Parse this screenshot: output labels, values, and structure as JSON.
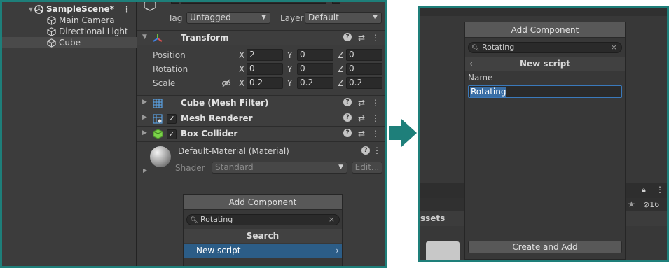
{
  "hierarchy": {
    "scene_name": "SampleScene*",
    "items": [
      "Main Camera",
      "Directional Light",
      "Cube"
    ],
    "selected_item": "Cube"
  },
  "inspector": {
    "tag_label": "Tag",
    "tag_value": "Untagged",
    "layer_label": "Layer",
    "layer_value": "Default",
    "transform": {
      "title": "Transform",
      "rows": [
        {
          "label": "Position",
          "x": "2",
          "y": "0",
          "z": "0"
        },
        {
          "label": "Rotation",
          "x": "0",
          "y": "0",
          "z": "0"
        },
        {
          "label": "Scale",
          "x": "0.2",
          "y": "0.2",
          "z": "0.2"
        }
      ],
      "axis_x": "X",
      "axis_y": "Y",
      "axis_z": "Z"
    },
    "components": [
      {
        "title": "Cube (Mesh Filter)",
        "icon": "mesh-filter-icon",
        "checkbox": false
      },
      {
        "title": "Mesh Renderer",
        "icon": "mesh-renderer-icon",
        "checkbox": true
      },
      {
        "title": "Box Collider",
        "icon": "box-collider-icon",
        "checkbox": true
      }
    ],
    "material": {
      "title": "Default-Material (Material)",
      "shader_label": "Shader",
      "shader_value": "Standard",
      "edit_label": "Edit..."
    }
  },
  "add_component_left": {
    "button_label": "Add Component",
    "search_value": "Rotating",
    "section_title": "Search",
    "selected_item": "New script"
  },
  "add_component_right": {
    "button_label": "Add Component",
    "search_value": "Rotating",
    "section_title": "New script",
    "name_label": "Name",
    "name_value": "Rotating",
    "create_button": "Create and Add",
    "background_assets_label": "ssets",
    "hidden_count": "16"
  },
  "colors": {
    "frame": "#1e7f7a",
    "selection": "#2c5d87",
    "panel_bg": "#383838"
  }
}
